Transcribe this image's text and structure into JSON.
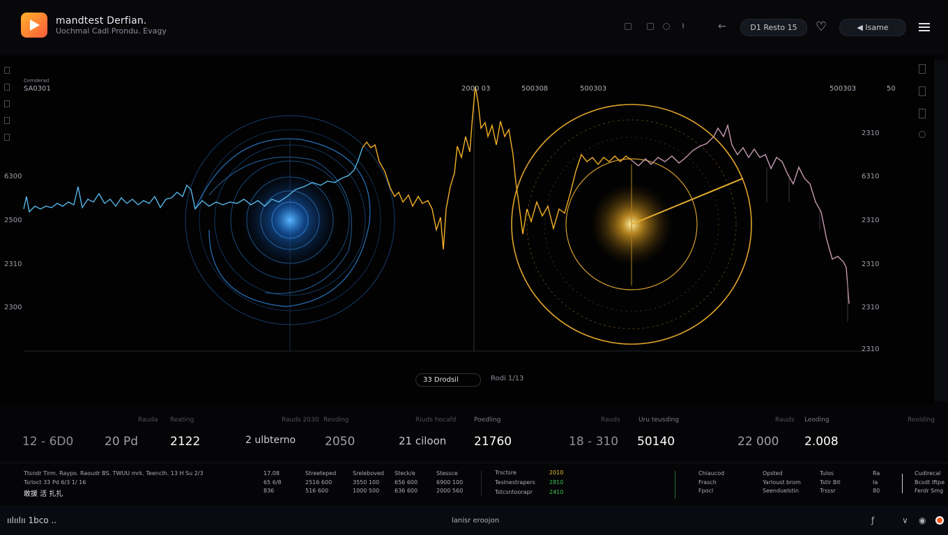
{
  "header": {
    "app_title": "mandtest Derfian.",
    "app_subtitle": "Uochmal Cadl Prondu. Evagy",
    "pill_primary": "D1 Resto 15",
    "pill_secondary": "Isame",
    "icons": [
      "play-icon",
      "cursor-icon",
      "square-icon",
      "circle-icon",
      "pointer-icon",
      "back-arrow-icon",
      "heart-icon",
      "menu-icon"
    ]
  },
  "chart": {
    "top_left_caption": "Cemderad",
    "top_left_value": "SA0301",
    "top_labels": [
      "2000 03",
      "500308",
      "500303",
      "500303",
      "50"
    ],
    "y_left": [
      "6300",
      "2500",
      "2310",
      "2300"
    ],
    "y_right": [
      "2310",
      "6310",
      "2310",
      "2310",
      "2310",
      "2310"
    ],
    "controls": {
      "pill": "33 Drodsil",
      "text": "Rodi 1/13"
    },
    "colors": {
      "blue": "#3fa9ff",
      "gold": "#f5b227",
      "mauve": "#c79ab2"
    }
  },
  "stats": [
    {
      "caption": "",
      "value": "12 - 6D0",
      "color": "#8c9099"
    },
    {
      "caption": "Rauda",
      "value": "20 Pd",
      "color": "#9da1a9"
    },
    {
      "caption": "Reating",
      "value": "2122",
      "color": "#ffffff"
    },
    {
      "caption": "Rauds 2030",
      "value": "2 ulbterno",
      "color": "#c9ccd2"
    },
    {
      "caption": "Revding",
      "value": "2050",
      "color": "#9da1a9"
    },
    {
      "caption": "Riuds hocafd",
      "value": "21 ciloon",
      "color": "#c9ccd2"
    },
    {
      "caption": "Poedling",
      "value": "21760",
      "color": "#ffffff"
    },
    {
      "caption": "Rauds",
      "value": "18 - 310",
      "color": "#8c9099"
    },
    {
      "caption": "Uru teusding",
      "value": "50140",
      "color": "#ffffff"
    },
    {
      "caption": "Rauds",
      "value": "22 000",
      "color": "#9da1a9"
    },
    {
      "caption": "Leoding",
      "value": "2.008",
      "color": "#ffffff"
    },
    {
      "caption": "Reolding",
      "value": "",
      "color": "#8c9099"
    }
  ],
  "table": {
    "left_line1": "Ttsndr Tirm. Raypo. Raoudr BS. TWUU mrk. Teenclh. 13 H Su 2/3",
    "left_line2": "Tsrloct 33 Pd 6/3 1/ 16",
    "left_line3": "敢援 活 扎扎",
    "col_a": [
      "17.08",
      "65 6/8",
      "836"
    ],
    "col_b": [
      "Streeteped",
      "2516 600",
      "516 600"
    ],
    "col_c": [
      "Sreleboved",
      "3550 100",
      "1000 500"
    ],
    "col_d": [
      "Steck/e",
      "656 600",
      "636 600"
    ],
    "col_e": [
      "Stessce",
      "6900 100",
      "2000 560"
    ],
    "col_f_labels": [
      "Trsctsre",
      "Teslnestrapers",
      "Tstcsntoorapr"
    ],
    "col_f_values": [
      "2010",
      "2810",
      "2410"
    ],
    "col_g": [
      "Chiaucod",
      "Frasch",
      "Fpocl"
    ],
    "col_h": [
      "Opsted",
      "Yarloust brom",
      "Seenduelstin"
    ],
    "col_i": [
      "Tulos",
      "Tstlr Bit",
      "Trsssr"
    ],
    "col_j": [
      "Ra",
      "Ia",
      "80"
    ],
    "col_k": [
      "Cudlrecal",
      "Bcsdt Iftpe",
      "Ferdr Smg"
    ]
  },
  "footer": {
    "left": "ıılıılıı 1bco ..",
    "center": "lanisr eroojon",
    "icons": [
      "flash-icon",
      "bird-icon",
      "user-icon",
      "record-icon"
    ]
  }
}
